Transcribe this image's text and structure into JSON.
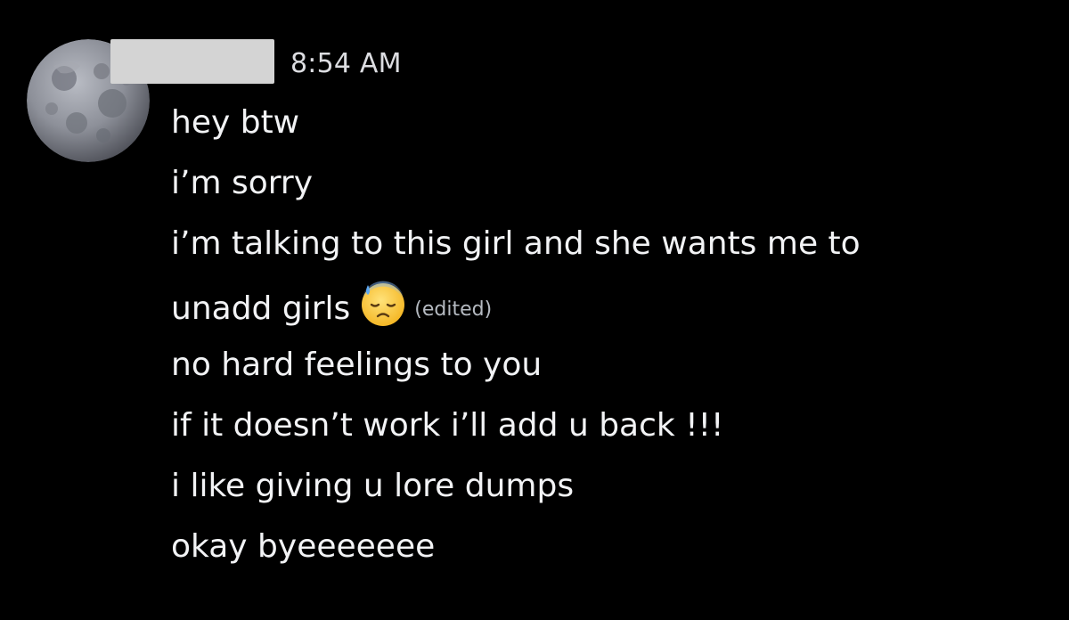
{
  "message": {
    "timestamp": "8:54 AM",
    "avatar_icon": "moon-avatar-icon",
    "lines": [
      {
        "text": "hey btw"
      },
      {
        "text": "i’m sorry"
      },
      {
        "text": "i’m talking to this girl and she wants me to"
      },
      {
        "text": "unadd girls",
        "emoji": "downcast-face-with-sweat-icon",
        "edited_label": "(edited)"
      },
      {
        "text": "no hard feelings to you"
      },
      {
        "text": "if it doesn’t work i’ll add u back !!!"
      },
      {
        "text": "i like giving u lore dumps"
      },
      {
        "text": "okay byeeeeeee"
      }
    ]
  },
  "colors": {
    "background": "#000000",
    "text": "#f2f3f5",
    "muted": "#b5bac1",
    "redaction": "#d4d4d4"
  }
}
